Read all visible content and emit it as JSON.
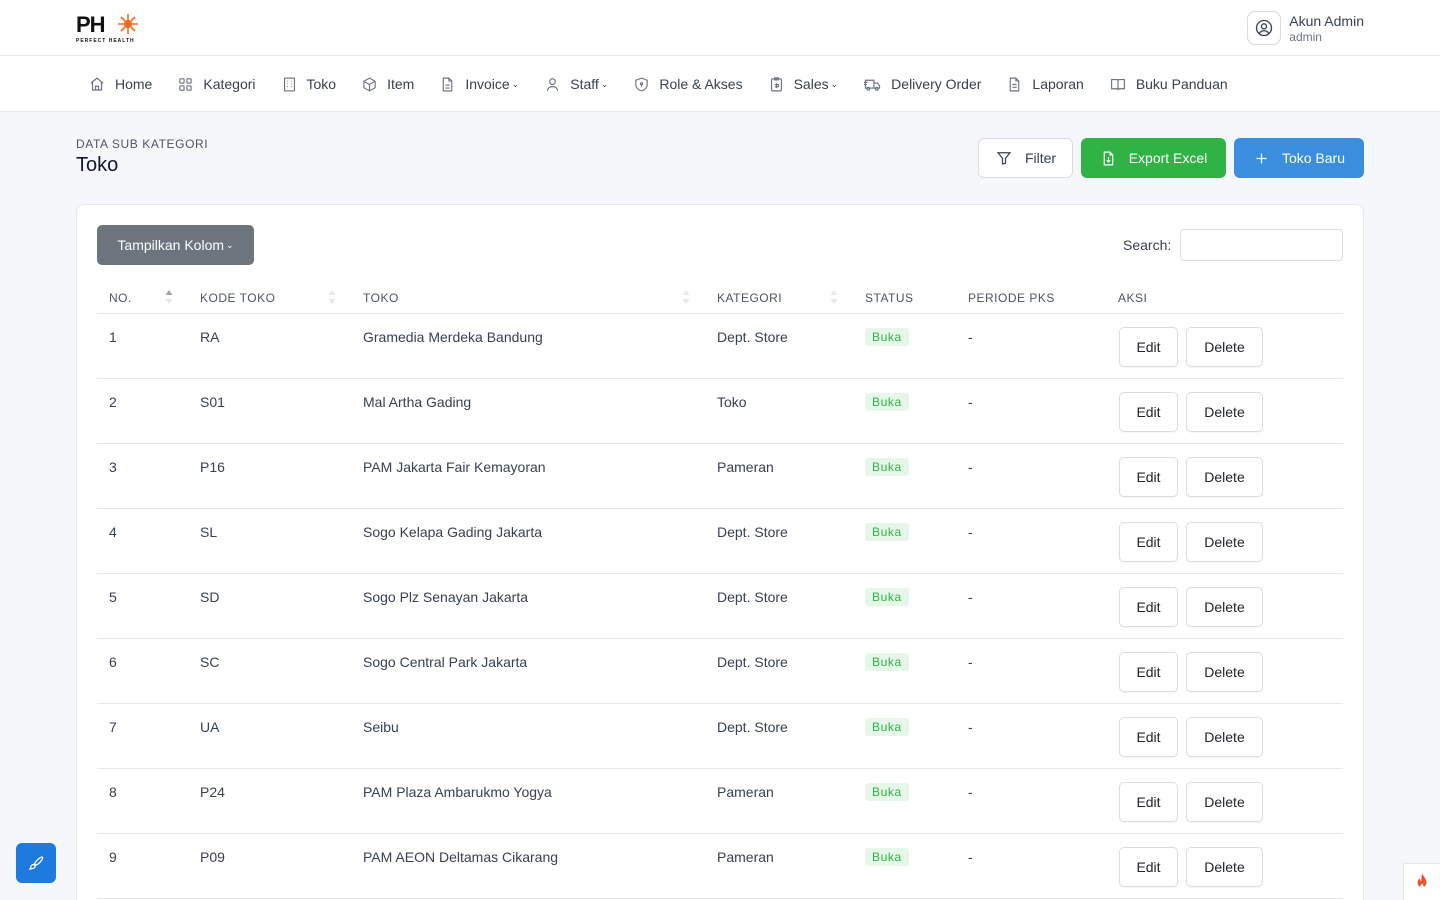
{
  "brand": {
    "logo_text": "PH",
    "logo_subtext": "PERFECT HEALTH"
  },
  "user": {
    "name": "Akun Admin",
    "role": "admin",
    "icon": "user-circle-icon"
  },
  "nav": [
    {
      "label": "Home",
      "icon": "home-icon",
      "dropdown": false
    },
    {
      "label": "Kategori",
      "icon": "grid-icon",
      "dropdown": false
    },
    {
      "label": "Toko",
      "icon": "building-icon",
      "dropdown": false
    },
    {
      "label": "Item",
      "icon": "box-icon",
      "dropdown": false
    },
    {
      "label": "Invoice",
      "icon": "file-invoice-icon",
      "dropdown": true
    },
    {
      "label": "Staff",
      "icon": "user-icon",
      "dropdown": true
    },
    {
      "label": "Role & Akses",
      "icon": "shield-icon",
      "dropdown": false
    },
    {
      "label": "Sales",
      "icon": "clipboard-icon",
      "dropdown": true
    },
    {
      "label": "Delivery Order",
      "icon": "truck-icon",
      "dropdown": false
    },
    {
      "label": "Laporan",
      "icon": "file-text-icon",
      "dropdown": false
    },
    {
      "label": "Buku Panduan",
      "icon": "book-icon",
      "dropdown": false
    }
  ],
  "page": {
    "breadcrumb": "DATA SUB KATEGORI",
    "title": "Toko"
  },
  "actions": {
    "filter_label": "Filter",
    "export_label": "Export Excel",
    "new_label": "Toko Baru",
    "colors": {
      "export": "#2fb344",
      "new": "#3b8ede",
      "columns": "#6c757d"
    }
  },
  "table_controls": {
    "columns_button": "Tampilkan Kolom",
    "search_label": "Search:",
    "search_value": ""
  },
  "table": {
    "headers": [
      "NO.",
      "KODE TOKO",
      "TOKO",
      "KATEGORI",
      "STATUS",
      "PERIODE PKS",
      "AKSI"
    ],
    "row_actions": {
      "edit": "Edit",
      "delete": "Delete"
    },
    "rows": [
      {
        "no": "1",
        "kode": "RA",
        "toko": "Gramedia Merdeka Bandung",
        "kategori": "Dept. Store",
        "status": "Buka",
        "periode": "-"
      },
      {
        "no": "2",
        "kode": "S01",
        "toko": "Mal Artha Gading",
        "kategori": "Toko",
        "status": "Buka",
        "periode": "-"
      },
      {
        "no": "3",
        "kode": "P16",
        "toko": "PAM Jakarta Fair Kemayoran",
        "kategori": "Pameran",
        "status": "Buka",
        "periode": "-"
      },
      {
        "no": "4",
        "kode": "SL",
        "toko": "Sogo Kelapa Gading Jakarta",
        "kategori": "Dept. Store",
        "status": "Buka",
        "periode": "-"
      },
      {
        "no": "5",
        "kode": "SD",
        "toko": "Sogo Plz Senayan Jakarta",
        "kategori": "Dept. Store",
        "status": "Buka",
        "periode": "-"
      },
      {
        "no": "6",
        "kode": "SC",
        "toko": "Sogo Central Park Jakarta",
        "kategori": "Dept. Store",
        "status": "Buka",
        "periode": "-"
      },
      {
        "no": "7",
        "kode": "UA",
        "toko": "Seibu",
        "kategori": "Dept. Store",
        "status": "Buka",
        "periode": "-"
      },
      {
        "no": "8",
        "kode": "P24",
        "toko": "PAM Plaza Ambarukmo Yogya",
        "kategori": "Pameran",
        "status": "Buka",
        "periode": "-"
      },
      {
        "no": "9",
        "kode": "P09",
        "toko": "PAM AEON Deltamas Cikarang",
        "kategori": "Pameran",
        "status": "Buka",
        "periode": "-"
      }
    ]
  },
  "floating": {
    "left_icon": "paintbrush-icon",
    "right_icon": "fire-icon"
  }
}
